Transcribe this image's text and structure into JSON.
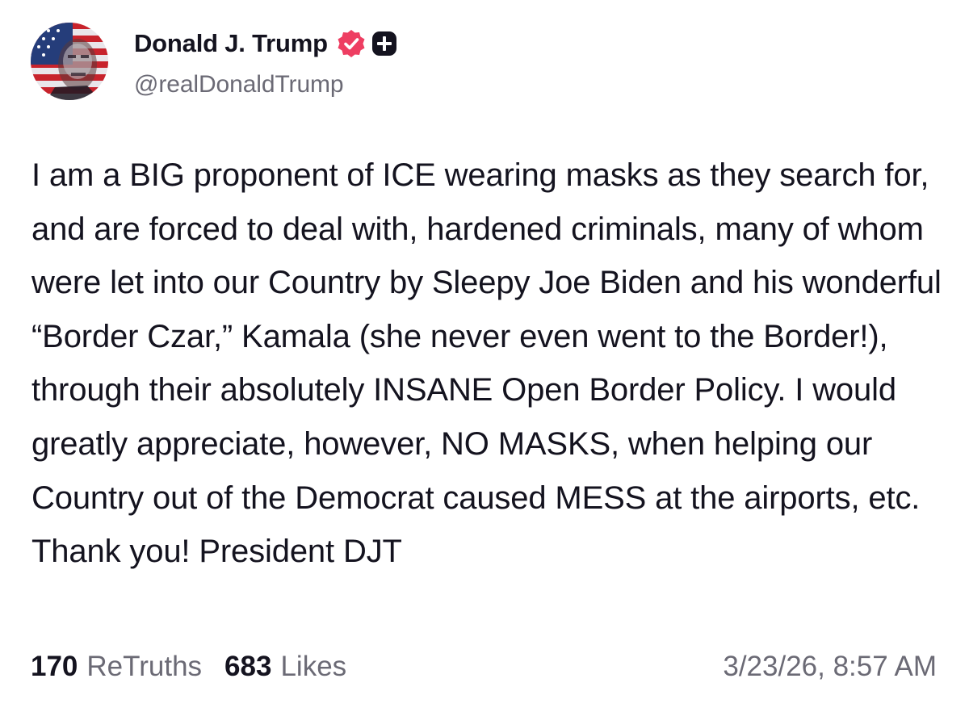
{
  "author": {
    "display_name": "Donald J. Trump",
    "handle": "@realDonaldTrump",
    "verified_icon": "verified-badge-icon",
    "plus_icon": "plus-badge-icon",
    "badge_color": "#ee3e62"
  },
  "post": {
    "text": "I am a BIG proponent of ICE wearing masks as they search for, and are forced to deal with, hardened criminals, many of whom were let into our Country by Sleepy Joe Biden and his wonderful “Border Czar,” Kamala (she never even went to the Border!), through their absolutely INSANE Open Border Policy. I would greatly appreciate, however, NO MASKS, when helping our Country out of the Democrat caused MESS at the airports, etc. Thank you! President DJT"
  },
  "stats": {
    "retruths_count": "170",
    "retruths_label": "ReTruths",
    "likes_count": "683",
    "likes_label": "Likes"
  },
  "timestamp": "3/23/26, 8:57 AM"
}
